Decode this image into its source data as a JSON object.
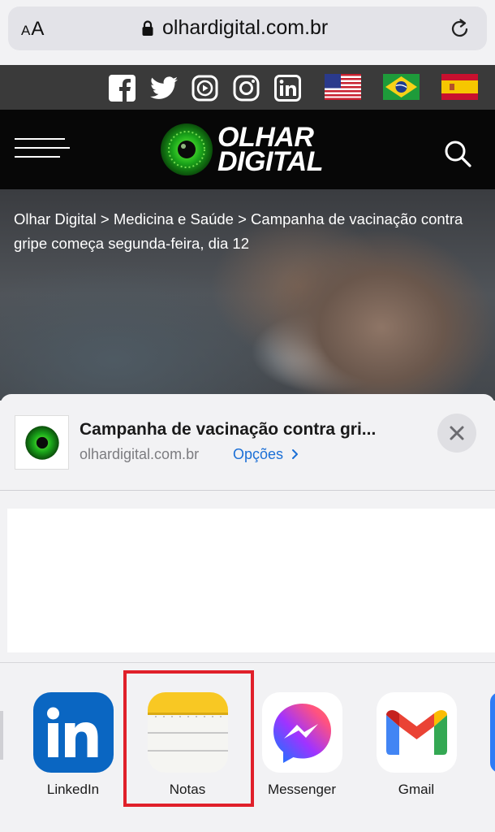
{
  "browser": {
    "text_size_label": "AA",
    "url": "olhardigital.com.br"
  },
  "social": {
    "icons": [
      "facebook-icon",
      "twitter-icon",
      "youtube-icon",
      "instagram-icon",
      "linkedin-icon"
    ],
    "flags": [
      "us-flag",
      "brazil-flag",
      "spain-flag"
    ]
  },
  "header": {
    "logo_line1": "OLHAR",
    "logo_line2": "DIGITAL"
  },
  "hero": {
    "breadcrumb": "Olhar Digital > Medicina e Saúde > Campanha de vacinação contra gripe começa segunda-feira, dia 12"
  },
  "share_sheet": {
    "title": "Campanha de vacinação contra gri...",
    "domain": "olhardigital.com.br",
    "options_label": "Opções",
    "apps": [
      {
        "label": "LinkedIn"
      },
      {
        "label": "Notas"
      },
      {
        "label": "Messenger"
      },
      {
        "label": "Gmail"
      }
    ]
  },
  "colors": {
    "options_link": "#1b6fd6",
    "highlight": "#e0202a",
    "linkedin": "#0a66c2",
    "notes_yellow": "#f8c823"
  }
}
